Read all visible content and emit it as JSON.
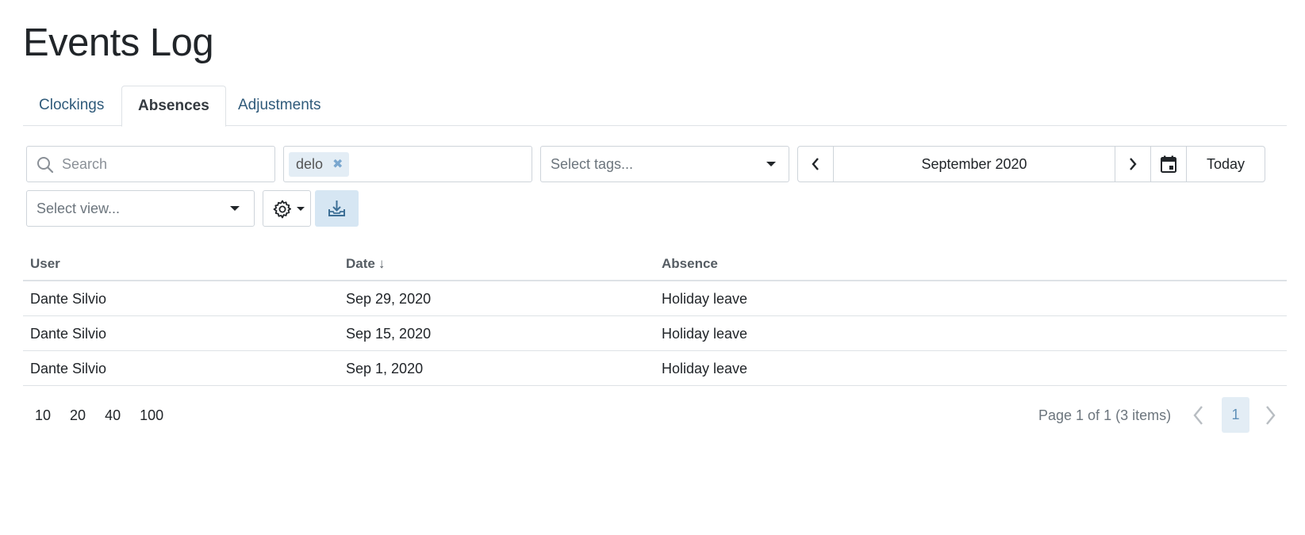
{
  "page": {
    "title": "Events Log"
  },
  "tabs": [
    {
      "label": "Clockings",
      "active": false
    },
    {
      "label": "Absences",
      "active": true
    },
    {
      "label": "Adjustments",
      "active": false
    }
  ],
  "toolbar": {
    "search_placeholder": "Search",
    "user_filter_chip": "delo",
    "tags_placeholder": "Select tags...",
    "period_label": "September 2020",
    "today_label": "Today",
    "view_placeholder": "Select view..."
  },
  "table": {
    "columns": [
      "User",
      "Date",
      "Absence"
    ],
    "sort_indicator": "↓",
    "rows": [
      {
        "user": "Dante Silvio",
        "date": "Sep 29, 2020",
        "absence": "Holiday leave"
      },
      {
        "user": "Dante Silvio",
        "date": "Sep 15, 2020",
        "absence": "Holiday leave"
      },
      {
        "user": "Dante Silvio",
        "date": "Sep 1, 2020",
        "absence": "Holiday leave"
      }
    ]
  },
  "pagination": {
    "page_sizes": [
      "10",
      "20",
      "40",
      "100"
    ],
    "info": "Page 1 of 1 (3 items)",
    "current_page": "1"
  },
  "colors": {
    "link": "#2f5a7a",
    "accent_bg": "#d6e6f3",
    "chip_bg": "#e3edf5",
    "border": "#ced4da"
  },
  "icons": [
    "search-icon",
    "chip-remove-icon",
    "chevron-down-icon",
    "chevron-left-icon",
    "chevron-right-icon",
    "calendar-icon",
    "gear-icon",
    "download-icon"
  ]
}
